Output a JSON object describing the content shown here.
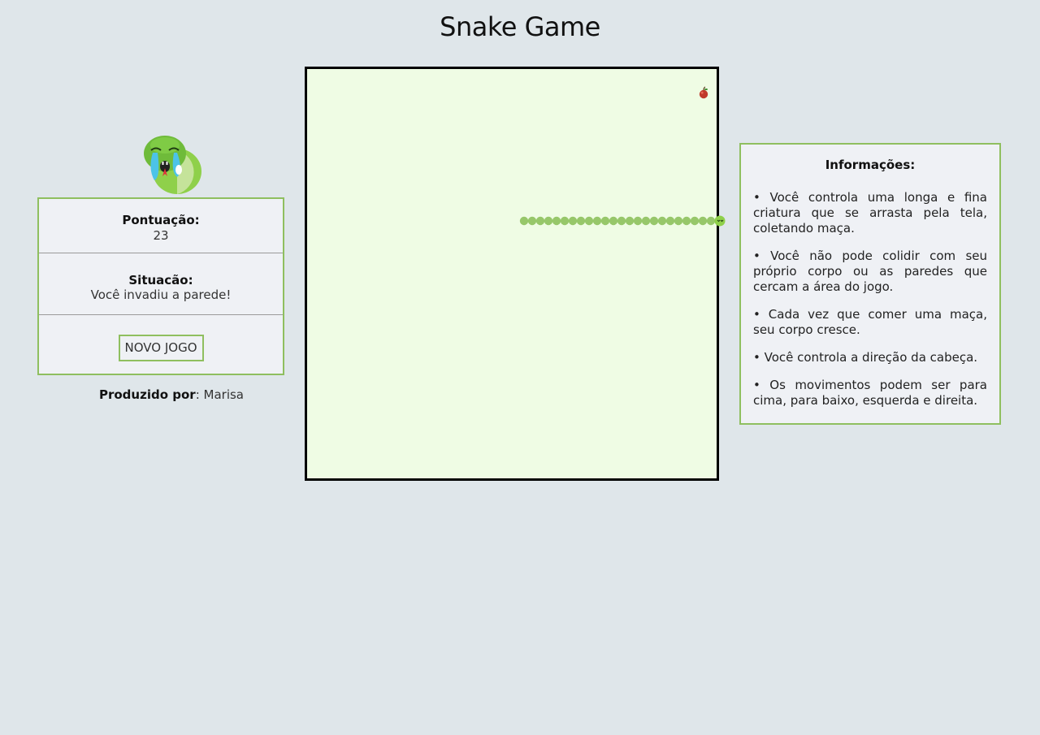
{
  "header": {
    "title": "Snake Game"
  },
  "status": {
    "score_label": "Pontuação:",
    "score_value": "23",
    "situation_label": "Situacão:",
    "situation_value": "Você invadiu a parede!",
    "new_game_label": "NOVO JOGO"
  },
  "credits": {
    "label": "Produzido por",
    "name": "Marisa"
  },
  "info": {
    "title": "Informações:",
    "items": [
      "• Você controla uma longa e fina criatura que se arrasta pela tela, coletando maça.",
      "• Você não pode colidir com seu próprio corpo ou as paredes que cercam a área do jogo.",
      "• Cada vez que comer uma maça, seu corpo cresce.",
      "• Você controla a direção da cabeça.",
      "• Os movimentos podem ser para cima, para baixo, esquerda e direita."
    ]
  },
  "icons": {
    "mascot": "crying-snake-icon",
    "food": "apple-icon",
    "snake_head": "snake-head-icon"
  },
  "colors": {
    "page_bg": "#dfe6ea",
    "board_bg": "#effce4",
    "accent_green": "#8fbf5f",
    "snake": "#97c76a",
    "apple": "#c0392b"
  }
}
